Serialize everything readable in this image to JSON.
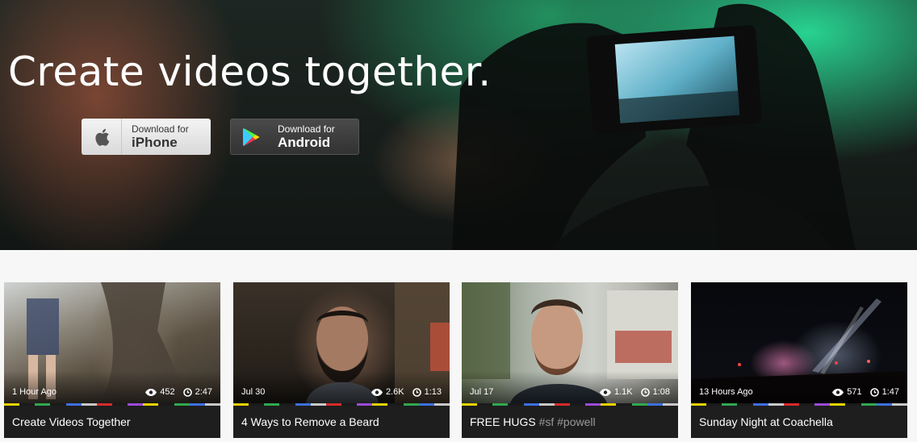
{
  "hero": {
    "title": "Create videos together.",
    "ios_button": {
      "small": "Download for",
      "big": "iPhone",
      "icon": "apple-icon"
    },
    "android_button": {
      "small": "Download for",
      "big": "Android",
      "icon": "play-store-icon"
    }
  },
  "stripe_colors": [
    "#e8d300",
    "#1a1a1a",
    "#2fa84f",
    "#1a1a1a",
    "#3d6fe0",
    "#c8c8c8",
    "#d52b2b",
    "#1a1a1a",
    "#9b4ad8",
    "#e8d300",
    "#1a1a1a",
    "#2fa84f",
    "#3d6fe0",
    "#c8c8c8"
  ],
  "videos": [
    {
      "time": "1 Hour Ago",
      "views": "452",
      "duration": "2:47",
      "title": "Create Videos Together",
      "tags": ""
    },
    {
      "time": "Jul 30",
      "views": "2.6K",
      "duration": "1:13",
      "title": "4 Ways to Remove a Beard",
      "tags": ""
    },
    {
      "time": "Jul 17",
      "views": "1.1K",
      "duration": "1:08",
      "title": "FREE HUGS",
      "tags": "#sf #powell"
    },
    {
      "time": "13 Hours Ago",
      "views": "571",
      "duration": "1:47",
      "title": "Sunday Night at Coachella",
      "tags": ""
    }
  ]
}
